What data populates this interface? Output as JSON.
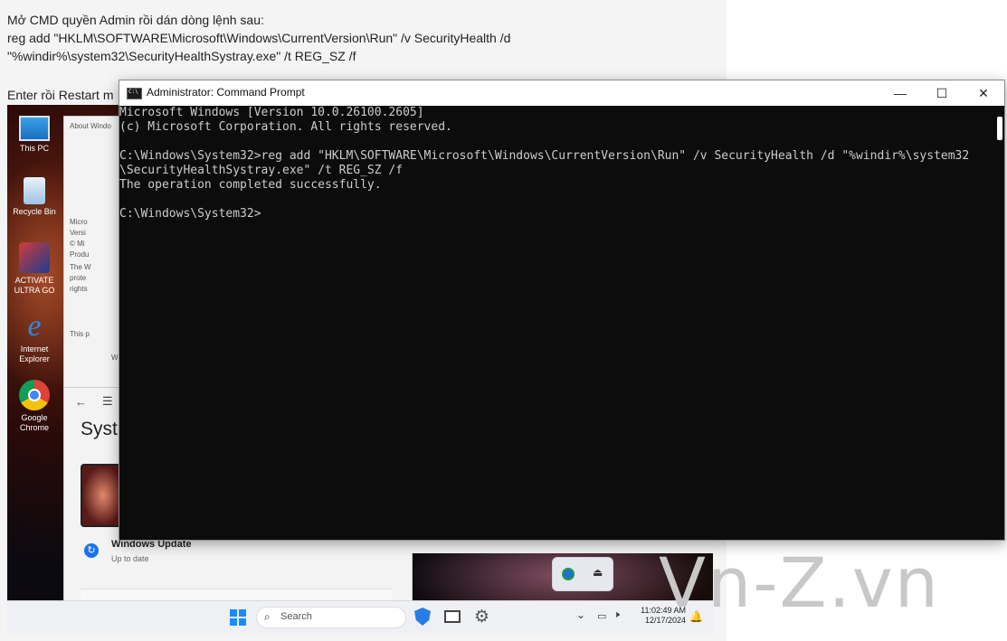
{
  "post": {
    "line1": "Mở CMD quyền Admin rồi dán dòng lệnh sau:",
    "line2": "reg add \"HKLM\\SOFTWARE\\Microsoft\\Windows\\CurrentVersion\\Run\" /v SecurityHealth /d",
    "line3": "\"%windir%\\system32\\SecurityHealthSystray.exe\" /t REG_SZ /f",
    "line4": "Enter rồi Restart m"
  },
  "desktop": {
    "icons": [
      {
        "label": "This PC",
        "icon": "computer-icon"
      },
      {
        "label": "Recycle Bin",
        "icon": "recycle-bin-icon"
      },
      {
        "label": "ACTIVATE ULTRA GO",
        "icon": "activate-icon"
      },
      {
        "label": "Internet Explorer",
        "icon": "ie-icon"
      },
      {
        "label": "Google Chrome",
        "icon": "chrome-icon"
      }
    ],
    "about_title": "About Windo",
    "about_lines": [
      "Micro",
      "Versi",
      "© Mi",
      "Produ",
      "The W",
      "prote",
      "rights"
    ],
    "about_extra": [
      "This p",
      "W"
    ],
    "settings_title": "Syst",
    "windows_update": "Windows Update",
    "up_to_date": "Up to date",
    "search_placeholder": "Search",
    "time": "11:02:49 AM",
    "date": "12/17/2024"
  },
  "cmd": {
    "title": "Administrator: Command Prompt",
    "minimize": "—",
    "maximize": "☐",
    "close": "✕",
    "console_lines": [
      "Microsoft Windows [Version 10.0.26100.2605]",
      "(c) Microsoft Corporation. All rights reserved.",
      "",
      "C:\\Windows\\System32>reg add \"HKLM\\SOFTWARE\\Microsoft\\Windows\\CurrentVersion\\Run\" /v SecurityHealth /d \"%windir%\\system32",
      "\\SecurityHealthSystray.exe\" /t REG_SZ /f",
      "The operation completed successfully.",
      "",
      "C:\\Windows\\System32>"
    ]
  },
  "watermark": "Vn-Z.vn"
}
